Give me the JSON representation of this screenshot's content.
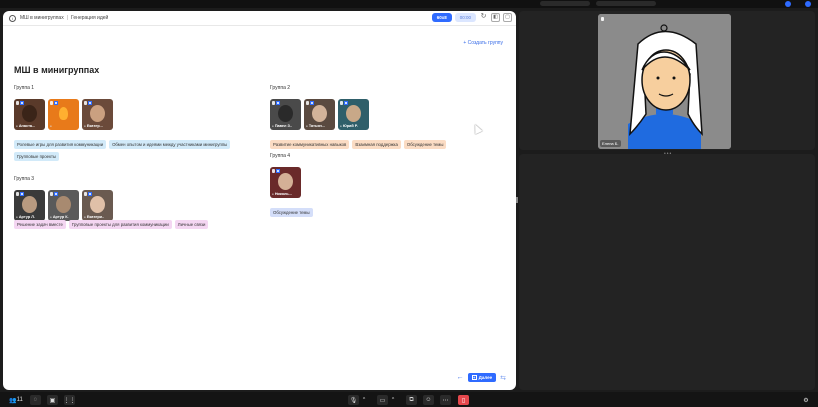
{
  "board": {
    "header_icon": "info-icon",
    "breadcrumb_title": "МШ в минигруппах",
    "breadcrumb_sub": "Генерация идей",
    "tag_active": "60x8",
    "tag_inactive": "00:00",
    "title": "МШ в минигруппах",
    "create_group": "+ Создать группу"
  },
  "groups": [
    {
      "title": "Группа 1",
      "participants": [
        "Анаста...",
        "",
        "Екатер..."
      ],
      "topics": [
        "Ролевые игры для развития коммуникации",
        "Обмен опытом и идеями между участниками минигруппы",
        "Групповые проекты"
      ],
      "color": "blue"
    },
    {
      "title": "Группа 2",
      "participants": [
        "Павел З..",
        "Татьян...",
        "Юрий Р."
      ],
      "topics": [
        "Развитие коммуникативных навыков",
        "Взаимная поддержка",
        "Обсуждение темы"
      ],
      "color": "orange"
    },
    {
      "title": "Группа 3",
      "participants": [
        "Артур Л.",
        "Артур К.",
        "Екатери.."
      ],
      "topics": [
        "Решение задач вместе",
        "Групповые проекты для развития коммуникации",
        "Личные связи"
      ],
      "color": "pink"
    },
    {
      "title": "Группа 4",
      "participants": [
        "Николь..."
      ],
      "topics": [
        "Обсуждение темы"
      ],
      "color": "indigo"
    }
  ],
  "nav": {
    "back": "←",
    "next": "Далее"
  },
  "video": {
    "participant_name": "Елена Б."
  },
  "bottom_bar": {
    "participants_count": "11",
    "icons": [
      "participants-icon",
      "chat-icon",
      "notes-icon",
      "grid-icon",
      "mic-icon",
      "camera-icon",
      "screen-share-icon",
      "reactions-icon",
      "more-icon",
      "leave-icon",
      "settings-icon"
    ]
  },
  "colors": {
    "accent": "#2f6bff",
    "chip_blue": "#d2eaf9",
    "chip_orange": "#fbdcc4",
    "chip_pink": "#f4d6f2",
    "chip_indigo": "#d4def9",
    "leave": "#e5484d"
  }
}
